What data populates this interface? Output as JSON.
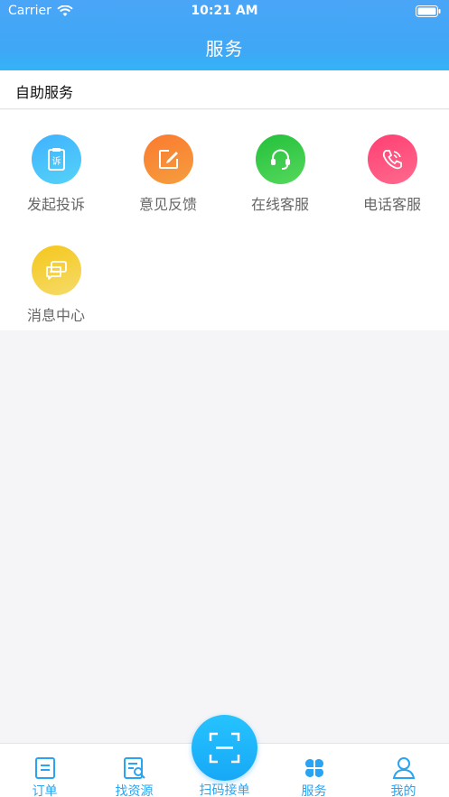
{
  "status_bar": {
    "carrier": "Carrier",
    "time": "10:21 AM"
  },
  "nav": {
    "title": "服务"
  },
  "section": {
    "title": "自助服务"
  },
  "services": [
    {
      "label": "发起投诉",
      "icon": "complaint-clipboard-icon",
      "color": "#3fb2ff"
    },
    {
      "label": "意见反馈",
      "icon": "edit-feedback-icon",
      "color": "#fb7a30"
    },
    {
      "label": "在线客服",
      "icon": "headset-icon",
      "color": "#23c03b"
    },
    {
      "label": "电话客服",
      "icon": "phone-icon",
      "color": "#ff3f73"
    },
    {
      "label": "消息中心",
      "icon": "chat-bubbles-icon",
      "color": "#f5c71b"
    }
  ],
  "tabbar": {
    "accent": "#28a4f2",
    "items": [
      {
        "label": "订单",
        "icon": "order-doc-icon"
      },
      {
        "label": "找资源",
        "icon": "search-doc-icon"
      },
      {
        "label": "扫码接单",
        "icon": "scan-icon"
      },
      {
        "label": "服务",
        "icon": "four-petal-icon"
      },
      {
        "label": "我的",
        "icon": "user-icon"
      }
    ]
  }
}
